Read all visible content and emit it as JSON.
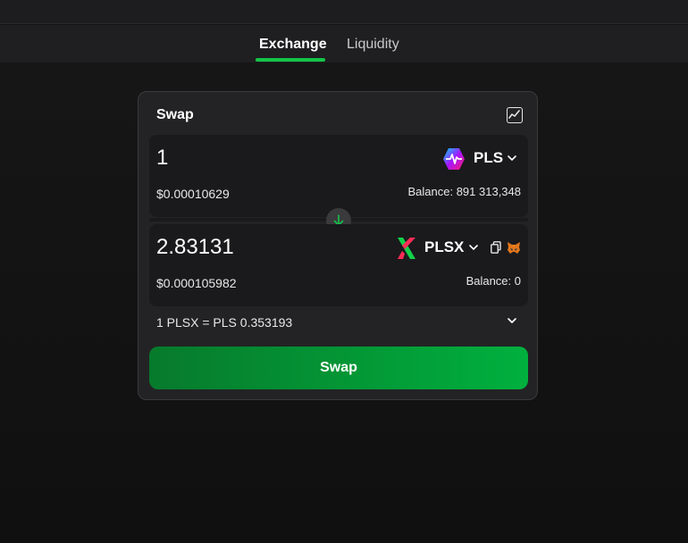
{
  "tabs": [
    {
      "label": "Exchange",
      "active": true
    },
    {
      "label": "Liquidity",
      "active": false
    }
  ],
  "card": {
    "title": "Swap",
    "chart_icon": "chart-line-icon"
  },
  "from": {
    "amount": "1",
    "usd": "$0.00010629",
    "token": "PLS",
    "token_icon": "pulsechain-logo-icon",
    "balance": "Balance: 891 313,348"
  },
  "to": {
    "amount": "2.83131",
    "usd": "$0.000105982",
    "token": "PLSX",
    "token_icon": "pulsex-logo-icon",
    "balance": "Balance: 0"
  },
  "rate": "1 PLSX = PLS 0.353193",
  "swap_button": "Swap",
  "colors": {
    "accent": "#14c44a",
    "button_from": "#077a2c",
    "button_to": "#00b03e"
  }
}
